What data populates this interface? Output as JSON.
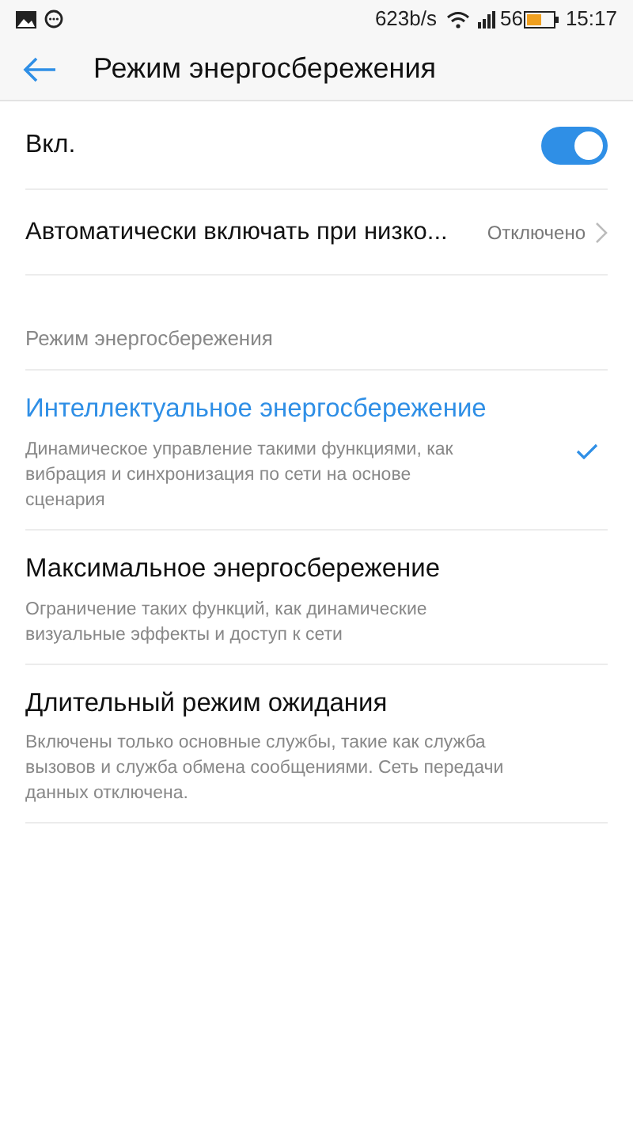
{
  "status_bar": {
    "speed": "623b/s",
    "battery_percent": "56",
    "time": "15:17"
  },
  "header": {
    "title": "Режим энергосбережения"
  },
  "power_switch": {
    "label": "Вкл.",
    "on": true
  },
  "auto_row": {
    "label": "Автоматически включать при низко...",
    "value": "Отключено"
  },
  "section_title": "Режим энергосбережения",
  "modes": [
    {
      "title": "Интеллектуальное энергосбережение",
      "description": "Динамическое управление такими функциями, как вибрация и синхронизация по сети на основе сценария",
      "selected": true
    },
    {
      "title": "Максимальное энергосбережение",
      "description": "Ограничение таких функций, как динамические визуальные эффекты и доступ к сети",
      "selected": false
    },
    {
      "title": "Длительный режим ожидания",
      "description": "Включены только основные службы, такие как служба вызовов и служба обмена сообщениями. Сеть передачи данных отключена.",
      "selected": false
    }
  ]
}
